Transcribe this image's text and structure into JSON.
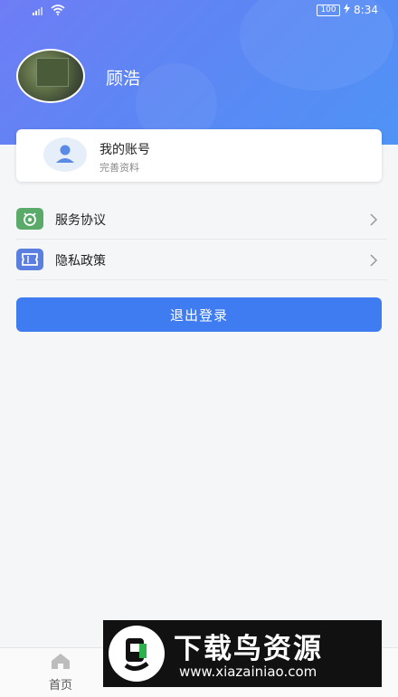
{
  "status_bar": {
    "battery": "100",
    "time": "8:34"
  },
  "profile": {
    "name": "顾浩"
  },
  "account_card": {
    "title": "我的账号",
    "subtitle": "完善资料"
  },
  "menu": [
    {
      "label": "服务协议",
      "icon": "agreement-icon",
      "color": "#5aaa6a"
    },
    {
      "label": "隐私政策",
      "icon": "ticket-icon",
      "color": "#5b7fe0"
    }
  ],
  "logout_label": "退出登录",
  "tabbar": {
    "home_label": "首页"
  },
  "watermark": {
    "text": "下载鸟资源",
    "url": "www.xiazainiao.com"
  },
  "colors": {
    "accent": "#3f7cf2",
    "header_start": "#6f7df5",
    "header_end": "#4f93f6"
  }
}
